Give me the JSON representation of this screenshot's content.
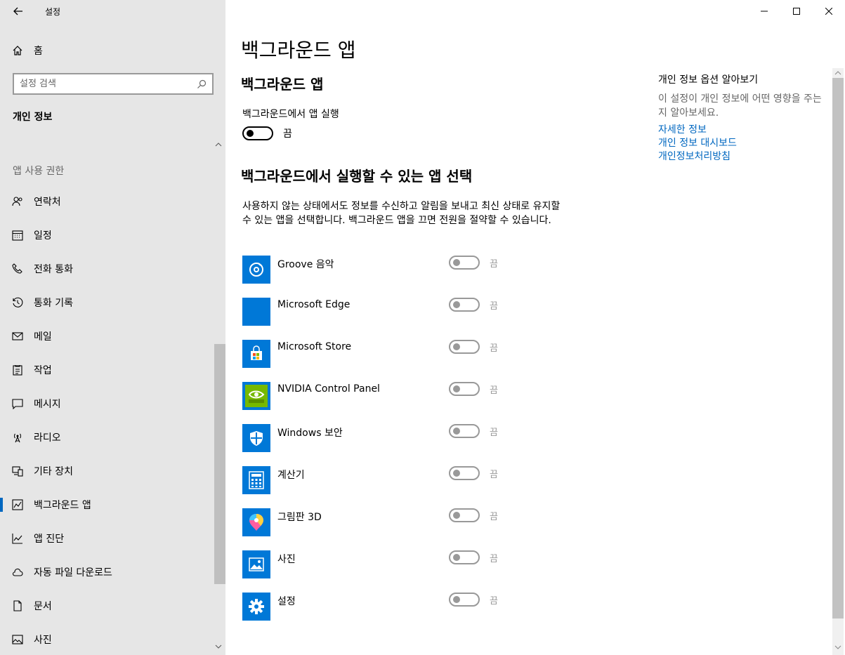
{
  "window": {
    "title": "설정"
  },
  "sidebar": {
    "home_label": "홈",
    "search_placeholder": "설정 검색",
    "section_title": "개인 정보",
    "group_label": "앱 사용 권한",
    "items": [
      {
        "label": "연락처",
        "icon": "contacts-icon"
      },
      {
        "label": "일정",
        "icon": "calendar-icon"
      },
      {
        "label": "전화 통화",
        "icon": "phone-icon"
      },
      {
        "label": "통화 기록",
        "icon": "history-icon"
      },
      {
        "label": "메일",
        "icon": "mail-icon"
      },
      {
        "label": "작업",
        "icon": "tasks-icon"
      },
      {
        "label": "메시지",
        "icon": "message-icon"
      },
      {
        "label": "라디오",
        "icon": "radio-icon"
      },
      {
        "label": "기타 장치",
        "icon": "devices-icon"
      },
      {
        "label": "백그라운드 앱",
        "icon": "background-apps-icon",
        "selected": true
      },
      {
        "label": "앱 진단",
        "icon": "diagnostics-icon"
      },
      {
        "label": "자동 파일 다운로드",
        "icon": "cloud-icon"
      },
      {
        "label": "문서",
        "icon": "document-icon"
      },
      {
        "label": "사진",
        "icon": "picture-icon"
      }
    ]
  },
  "main": {
    "page_title": "백그라운드 앱",
    "sub_title": "백그라운드 앱",
    "run_label": "백그라운드에서 앱 실행",
    "run_state": "끔",
    "choose_title": "백그라운드에서 실행할 수 있는 앱 선택",
    "description": "사용하지 않는 상태에서도 정보를 수신하고 알림을 보내고 최신 상태로 유지할 수 있는 앱을 선택합니다. 백그라운드 앱을 끄면 전원을 절약할 수 있습니다.",
    "apps": [
      {
        "name": "Groove 음악",
        "state": "끔",
        "icon": "groove-music-icon"
      },
      {
        "name": "Microsoft Edge",
        "state": "끔",
        "icon": "edge-icon"
      },
      {
        "name": "Microsoft Store",
        "state": "끔",
        "icon": "store-icon"
      },
      {
        "name": "NVIDIA Control Panel",
        "state": "끔",
        "icon": "nvidia-icon"
      },
      {
        "name": "Windows 보안",
        "state": "끔",
        "icon": "shield-icon"
      },
      {
        "name": "계산기",
        "state": "끔",
        "icon": "calculator-icon"
      },
      {
        "name": "그림판 3D",
        "state": "끔",
        "icon": "paint3d-icon"
      },
      {
        "name": "사진",
        "state": "끔",
        "icon": "photos-icon"
      },
      {
        "name": "설정",
        "state": "끔",
        "icon": "settings-gear-icon"
      }
    ]
  },
  "aside": {
    "title": "개인 정보 옵션 알아보기",
    "description": "이 설정이 개인 정보에 어떤 영향을 주는지 알아보세요.",
    "links": [
      "자세한 정보",
      "개인 정보 대시보드",
      "개인정보처리방침"
    ]
  },
  "colors": {
    "accent": "#0078d7",
    "link": "#0067c0",
    "sidebar_bg": "#e6e6e6"
  }
}
